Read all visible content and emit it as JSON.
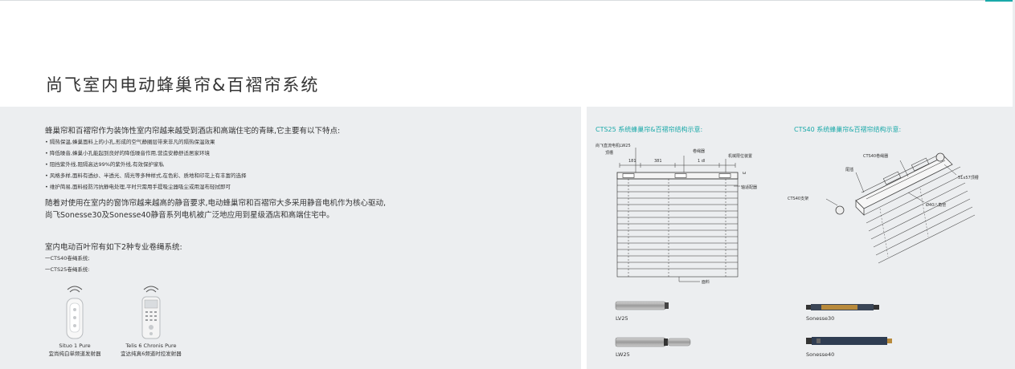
{
  "page": {
    "title": "尚飞室内电动蜂巢帘&百褶帘系统"
  },
  "intro": {
    "lead": "蜂巢帘和百褶帘作为装饰性室内帘越来越受到酒店和高端住宅的青睐,它主要有以下特点:",
    "bullets": [
      "• 隔热保温,蜂巢面料上的小孔,形成的空气静圈层带来非凡的隔热保温效果",
      "• 降低噪音,蜂巢小孔能起到良好的降低噪音作用,营造安静舒适居家环境",
      "• 阻挡紫外线,阻隔高达99%的紫外线,有效保护家私",
      "• 风格多样,面料有透纱、半透光、隔光等多种样式,在色彩、质地和印花上有丰富的选择",
      "• 维护简易,面料经防污抗静电处理,平时只需用手提吸尘器吸尘或用湿布轻拭即可"
    ],
    "paragraph_lines": [
      "随着对使用在室内的窗饰帘越来越高的静音要求,电动蜂巢帘和百褶帘大多采用静音电机作为核心驱动,",
      "尚飞Sonesse30及Sonesse40静音系列电机被广泛地应用到星级酒店和高端住宅中。"
    ]
  },
  "systems": {
    "heading": "室内电动百叶帘有如下2种专业卷绳系统:",
    "items": [
      "一CTS40卷绳系统;",
      "一CTS25卷绳系统:"
    ]
  },
  "remotes": [
    {
      "name": "Situo 1 Pure",
      "desc": "宜尚纯白单频道发射器"
    },
    {
      "name": "Telis 6 Chronis Pure",
      "desc": "宜达纯真6频道时控发射器"
    }
  ],
  "diagram_cts25": {
    "title": "CTS25 系统蜂巢帘&百褶帘结构示意:",
    "labels": {
      "motor": "尚飞直流电机LW25",
      "top_rail": "顶槽",
      "dim1": "181",
      "dim2": "381",
      "winder": "卷绳器",
      "dim3": "1 dl",
      "limit": "机械限位装置",
      "coupler": "轴适配器",
      "fabric": "面料",
      "mark": "ω"
    }
  },
  "diagram_cts40": {
    "title": "CTS40 系统蜂巢帘&百褶帘结构示意:",
    "labels": {
      "winder": "CTS40卷绳器",
      "end_cap": "尾插",
      "top_rail": "51x57顶槽",
      "bracket": "CTS40支架",
      "tube": "Ø40八角管"
    }
  },
  "motors": [
    {
      "name": "LV25"
    },
    {
      "name": "LW25"
    },
    {
      "name": "Sonesse30"
    },
    {
      "name": "Sonesse40"
    }
  ],
  "colors": {
    "accent": "#1aa9a9",
    "panel": "#eceef0",
    "text": "#333333"
  }
}
